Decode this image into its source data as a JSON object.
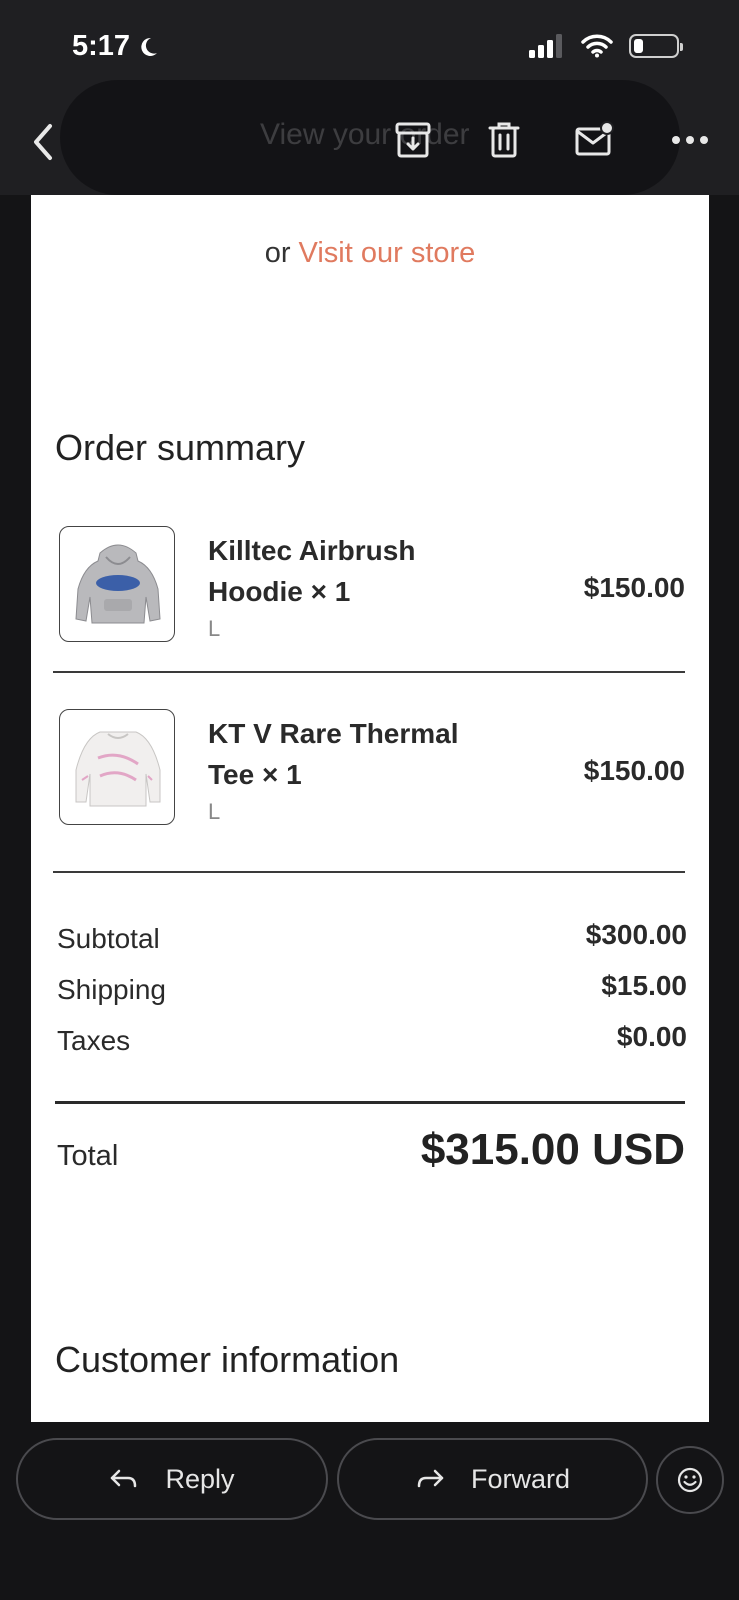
{
  "status_bar": {
    "time": "5:17"
  },
  "header": {
    "subject_faded": "View your order"
  },
  "email": {
    "visit_prefix": "or",
    "visit_link": "Visit our store",
    "order_summary_title": "Order summary",
    "items": [
      {
        "name": "Killtec Airbrush Hoodie × 1",
        "variant": "L",
        "price": "$150.00"
      },
      {
        "name": "KT V Rare Thermal Tee × 1",
        "variant": "L",
        "price": "$150.00"
      }
    ],
    "totals": [
      {
        "label": "Subtotal",
        "value": "$300.00"
      },
      {
        "label": "Shipping",
        "value": "$15.00"
      },
      {
        "label": "Taxes",
        "value": "$0.00"
      }
    ],
    "total_label": "Total",
    "total_value": "$315.00 USD",
    "customer_info_title": "Customer information"
  },
  "actions": {
    "reply": "Reply",
    "forward": "Forward"
  },
  "colors": {
    "link": "#e07a5f",
    "background": "#141416",
    "header": "#1f1f22"
  }
}
